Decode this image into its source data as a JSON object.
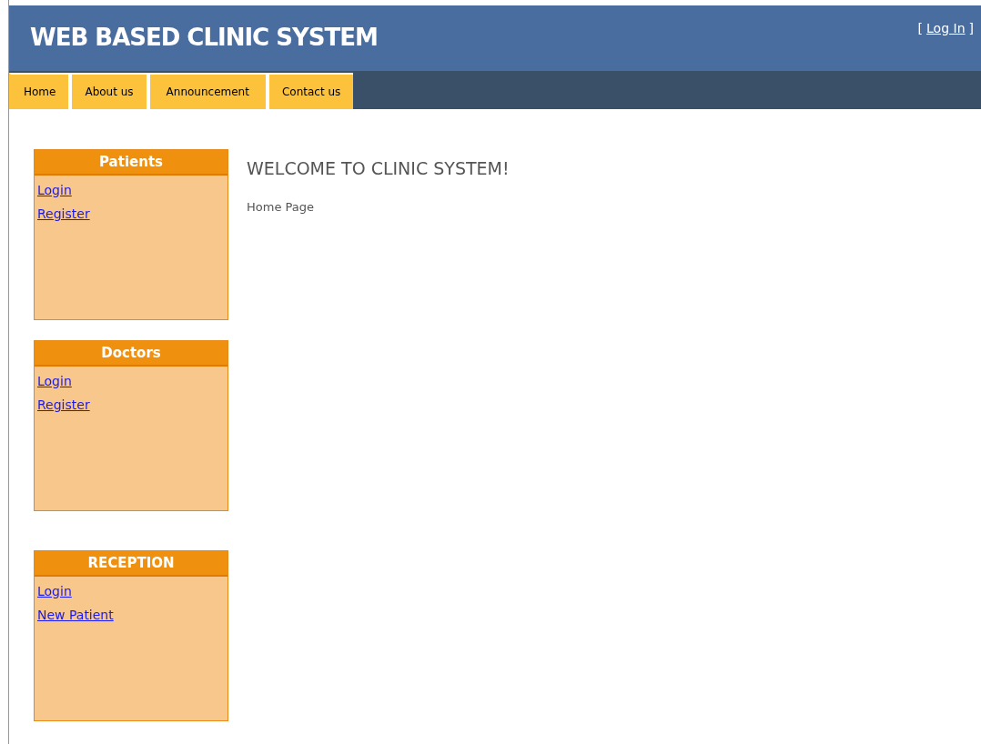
{
  "header": {
    "title": "WEB BASED CLINIC SYSTEM",
    "login_link": {
      "open": "[",
      "label": "Log In",
      "close": "]"
    }
  },
  "nav": [
    "Home",
    "About us",
    "Announcement",
    "Contact us"
  ],
  "panels": [
    {
      "title": "Patients",
      "links": [
        "Login",
        "Register"
      ]
    },
    {
      "title": "Doctors",
      "links": [
        "Login",
        "Register"
      ]
    },
    {
      "title": "RECEPTION",
      "links": [
        "Login",
        "New Patient"
      ]
    }
  ],
  "main": {
    "heading": "WELCOME TO CLINIC SYSTEM!",
    "text": "Home Page"
  }
}
